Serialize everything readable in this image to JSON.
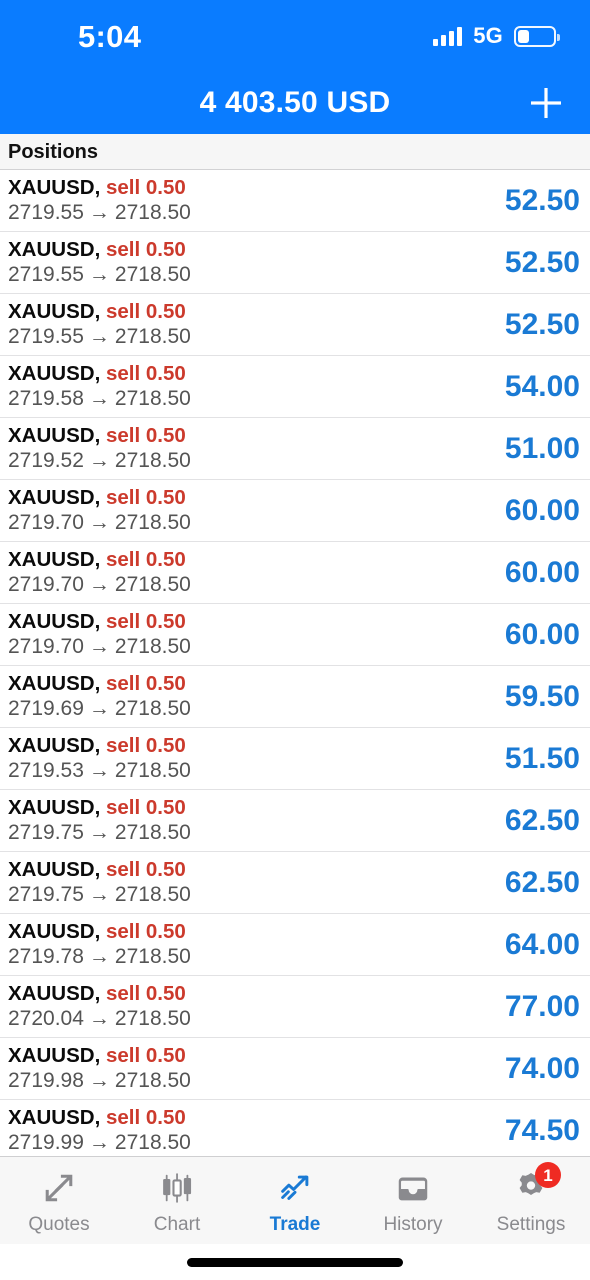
{
  "status_bar": {
    "time": "5:04",
    "network": "5G",
    "signal_icon": "signal-bars-icon",
    "battery_icon": "battery-icon",
    "battery_level_percent": 32
  },
  "header": {
    "balance": "4 403.50 USD",
    "add_icon": "plus-icon",
    "background_color": "#0a7cff"
  },
  "section": {
    "title": "Positions"
  },
  "colors": {
    "accent_blue": "#0a7cff",
    "profit_blue": "#1a7ad4",
    "sell_red": "#cc3a2c",
    "badge_red": "#ef2b23",
    "muted_gray": "#8a8a8e"
  },
  "positions": [
    {
      "symbol": "XAUUSD,",
      "side": "sell 0.50",
      "open_price": "2719.55",
      "arrow": "→",
      "current_price": "2718.50",
      "profit": "52.50"
    },
    {
      "symbol": "XAUUSD,",
      "side": "sell 0.50",
      "open_price": "2719.55",
      "arrow": "→",
      "current_price": "2718.50",
      "profit": "52.50"
    },
    {
      "symbol": "XAUUSD,",
      "side": "sell 0.50",
      "open_price": "2719.55",
      "arrow": "→",
      "current_price": "2718.50",
      "profit": "52.50"
    },
    {
      "symbol": "XAUUSD,",
      "side": "sell 0.50",
      "open_price": "2719.58",
      "arrow": "→",
      "current_price": "2718.50",
      "profit": "54.00"
    },
    {
      "symbol": "XAUUSD,",
      "side": "sell 0.50",
      "open_price": "2719.52",
      "arrow": "→",
      "current_price": "2718.50",
      "profit": "51.00"
    },
    {
      "symbol": "XAUUSD,",
      "side": "sell 0.50",
      "open_price": "2719.70",
      "arrow": "→",
      "current_price": "2718.50",
      "profit": "60.00"
    },
    {
      "symbol": "XAUUSD,",
      "side": "sell 0.50",
      "open_price": "2719.70",
      "arrow": "→",
      "current_price": "2718.50",
      "profit": "60.00"
    },
    {
      "symbol": "XAUUSD,",
      "side": "sell 0.50",
      "open_price": "2719.70",
      "arrow": "→",
      "current_price": "2718.50",
      "profit": "60.00"
    },
    {
      "symbol": "XAUUSD,",
      "side": "sell 0.50",
      "open_price": "2719.69",
      "arrow": "→",
      "current_price": "2718.50",
      "profit": "59.50"
    },
    {
      "symbol": "XAUUSD,",
      "side": "sell 0.50",
      "open_price": "2719.53",
      "arrow": "→",
      "current_price": "2718.50",
      "profit": "51.50"
    },
    {
      "symbol": "XAUUSD,",
      "side": "sell 0.50",
      "open_price": "2719.75",
      "arrow": "→",
      "current_price": "2718.50",
      "profit": "62.50"
    },
    {
      "symbol": "XAUUSD,",
      "side": "sell 0.50",
      "open_price": "2719.75",
      "arrow": "→",
      "current_price": "2718.50",
      "profit": "62.50"
    },
    {
      "symbol": "XAUUSD,",
      "side": "sell 0.50",
      "open_price": "2719.78",
      "arrow": "→",
      "current_price": "2718.50",
      "profit": "64.00"
    },
    {
      "symbol": "XAUUSD,",
      "side": "sell 0.50",
      "open_price": "2720.04",
      "arrow": "→",
      "current_price": "2718.50",
      "profit": "77.00"
    },
    {
      "symbol": "XAUUSD,",
      "side": "sell 0.50",
      "open_price": "2719.98",
      "arrow": "→",
      "current_price": "2718.50",
      "profit": "74.00"
    },
    {
      "symbol": "XAUUSD,",
      "side": "sell 0.50",
      "open_price": "2719.99",
      "arrow": "→",
      "current_price": "2718.50",
      "profit": "74.50"
    }
  ],
  "tab_bar": {
    "items": [
      {
        "label": "Quotes",
        "icon": "quotes-arrows-icon",
        "active": false,
        "badge": null
      },
      {
        "label": "Chart",
        "icon": "candlestick-chart-icon",
        "active": false,
        "badge": null
      },
      {
        "label": "Trade",
        "icon": "trending-up-arrow-icon",
        "active": true,
        "badge": null
      },
      {
        "label": "History",
        "icon": "inbox-tray-icon",
        "active": false,
        "badge": null
      },
      {
        "label": "Settings",
        "icon": "gear-icon",
        "active": false,
        "badge": "1"
      }
    ]
  }
}
